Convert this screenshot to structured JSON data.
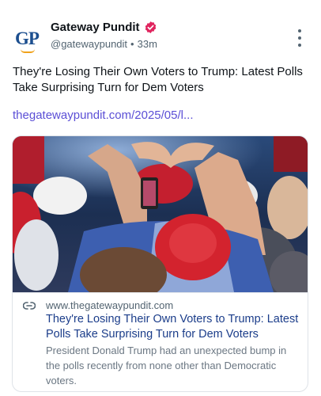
{
  "account": {
    "avatar_text": "GP",
    "name": "Gateway Pundit",
    "handle": "@gatewaypundit",
    "separator": "•",
    "time": "33m"
  },
  "post": {
    "text": "They're Losing Their Own Voters to Trump: Latest Polls Take Surprising Turn for Dem Voters",
    "link_text": "thegatewaypundit.com/2025/05/l..."
  },
  "card": {
    "domain": "www.thegatewaypundit.com",
    "title": "They're Losing Their Own Voters to Trump: Latest Polls Take Surprising Turn for Dem Voters",
    "description": "President Donald Trump had an unexpected bump in the polls recently from none other than Democratic voters."
  },
  "icons": {
    "verified": "verified-badge-icon",
    "more": "more-vertical-icon",
    "link": "link-icon"
  },
  "colors": {
    "verified": "#e0245e",
    "link": "#5b4fd6",
    "card_title": "#1b3d8a",
    "avatar_text": "#1c4f8f"
  }
}
